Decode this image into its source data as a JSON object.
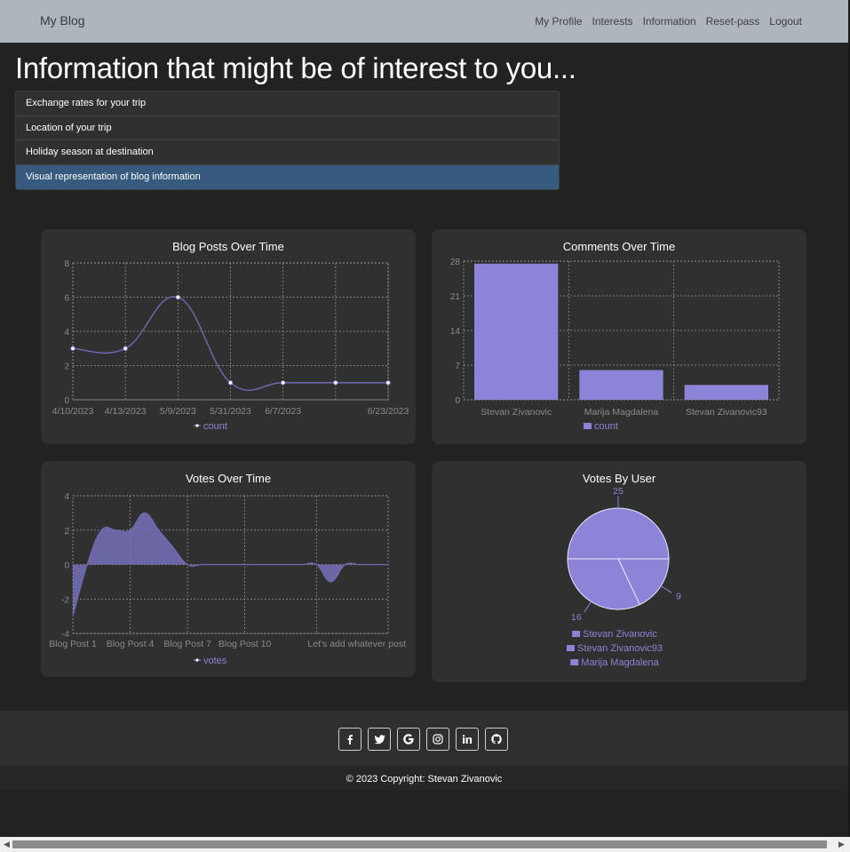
{
  "navbar": {
    "brand": "My Blog",
    "links": [
      "My Profile",
      "Interests",
      "Information",
      "Reset-pass",
      "Logout"
    ]
  },
  "page": {
    "heading": "Information that might be of interest to you..."
  },
  "info_list": [
    {
      "label": "Exchange rates for your trip",
      "active": false
    },
    {
      "label": "Location of your trip",
      "active": false
    },
    {
      "label": "Holiday season at destination",
      "active": false
    },
    {
      "label": "Visual representation of blog information",
      "active": true
    }
  ],
  "colors": {
    "accent": "#8b84d7",
    "active_item": "#375a7f",
    "card": "#303030",
    "background": "#222222",
    "navbar": "#aeb5bd"
  },
  "chart_data": [
    {
      "type": "line",
      "title": "Blog Posts Over Time",
      "x": [
        "4/10/2023",
        "4/13/2023",
        "5/9/2023",
        "5/31/2023",
        "6/7/2023",
        "",
        "6/23/2023"
      ],
      "series": [
        {
          "name": "count",
          "values": [
            3,
            3,
            6,
            1,
            1,
            1,
            1
          ]
        }
      ],
      "ylim": [
        0,
        8
      ],
      "yticks": [
        0,
        2,
        4,
        6,
        8
      ],
      "grid": true,
      "legend": "bottom"
    },
    {
      "type": "bar",
      "title": "Comments Over Time",
      "categories": [
        "Stevan Zivanovic",
        "Marija Magdalena",
        "Stevan Zivanovic93"
      ],
      "series": [
        {
          "name": "count",
          "values": [
            27.5,
            6,
            3
          ]
        }
      ],
      "ylim": [
        0,
        28
      ],
      "yticks": [
        0,
        7,
        14,
        21,
        28
      ],
      "grid": true,
      "legend": "bottom"
    },
    {
      "type": "area",
      "title": "Votes Over Time",
      "x": [
        "Blog Post 1",
        "Blog Post 4",
        "Blog Post 7",
        "Blog Post 10",
        "Let's add whatever post"
      ],
      "series": [
        {
          "name": "votes",
          "values": [
            -3,
            0,
            2,
            2,
            2,
            3,
            2,
            1,
            0,
            0,
            0,
            0,
            0,
            0,
            0,
            0,
            0,
            0,
            -1,
            0,
            0,
            0,
            0
          ]
        }
      ],
      "ylim": [
        -4,
        4
      ],
      "yticks": [
        -4,
        -2,
        0,
        2,
        4
      ],
      "grid": true,
      "legend": "bottom"
    },
    {
      "type": "pie",
      "title": "Votes By User",
      "categories": [
        "Stevan Zivanovic",
        "Stevan Zivanovic93",
        "Marija Magdalena"
      ],
      "values": [
        25,
        9,
        16
      ],
      "legend": "bottom"
    }
  ],
  "footer": {
    "social_icons": [
      "facebook-icon",
      "twitter-icon",
      "google-icon",
      "instagram-icon",
      "linkedin-icon",
      "github-icon"
    ],
    "copyright": "© 2023 Copyright: Stevan Zivanovic"
  }
}
